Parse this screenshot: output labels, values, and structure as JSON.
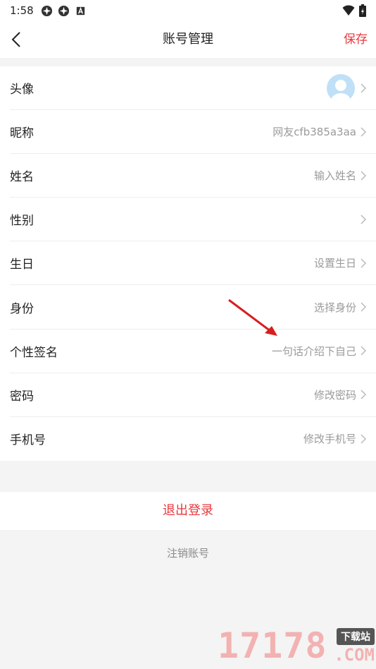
{
  "status_bar": {
    "time": "1:58",
    "icons_left": [
      "app-icon",
      "app-icon",
      "a-icon"
    ],
    "icons_right": [
      "wifi-icon",
      "battery-icon"
    ]
  },
  "header": {
    "title": "账号管理",
    "save_label": "保存"
  },
  "rows": [
    {
      "label": "头像",
      "value": ""
    },
    {
      "label": "昵称",
      "value": "网友cfb385a3aa"
    },
    {
      "label": "姓名",
      "value": "输入姓名"
    },
    {
      "label": "性别",
      "value": ""
    },
    {
      "label": "生日",
      "value": "设置生日"
    },
    {
      "label": "身份",
      "value": "选择身份"
    },
    {
      "label": "个性签名",
      "value": "一句话介绍下自己"
    },
    {
      "label": "密码",
      "value": "修改密码"
    },
    {
      "label": "手机号",
      "value": "修改手机号"
    }
  ],
  "logout_label": "退出登录",
  "cancel_account_label": "注销账号",
  "watermark": {
    "number": "17178",
    "tag": "下载站",
    "suffix": ".COM"
  },
  "colors": {
    "accent": "#e8393e",
    "background": "#f4f4f4",
    "muted_text": "#9a9a9a"
  }
}
